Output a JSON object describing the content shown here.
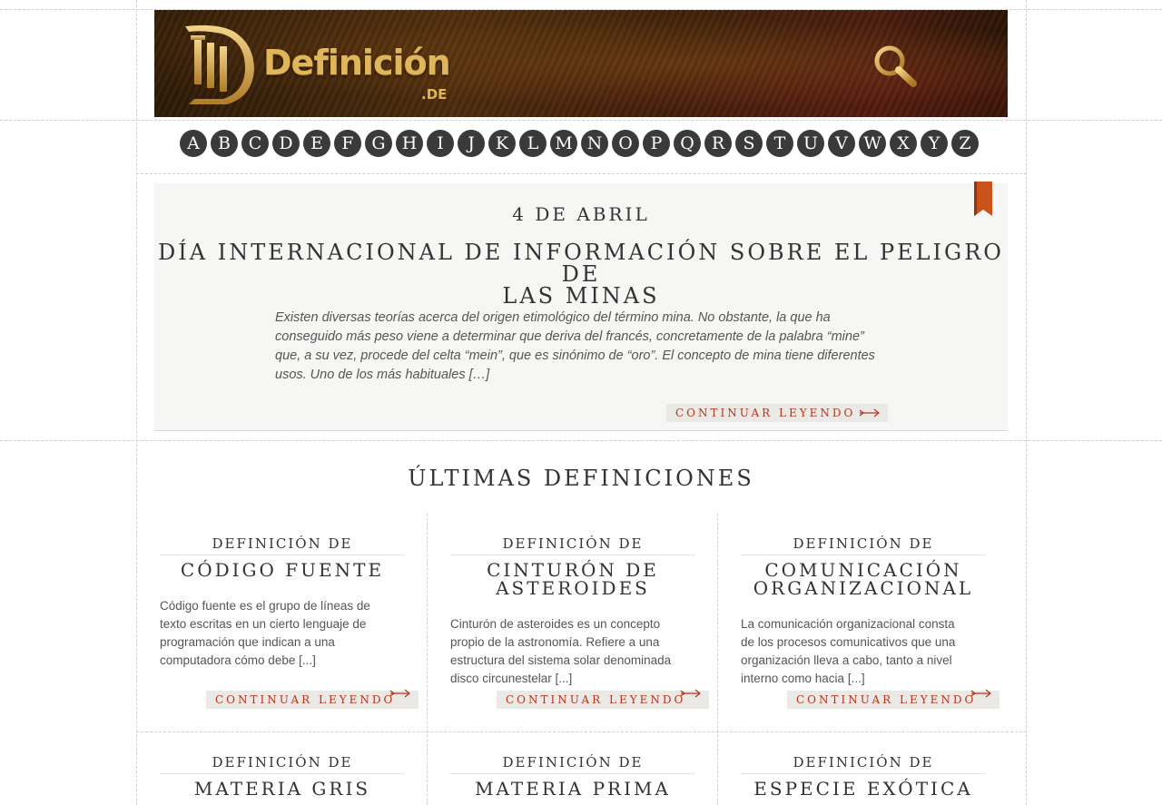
{
  "header": {
    "logo_name": "Definición",
    "logo_tld": ".DE",
    "search_icon": "magnifier-icon"
  },
  "alphabet": [
    "A",
    "B",
    "C",
    "D",
    "E",
    "F",
    "G",
    "H",
    "I",
    "J",
    "K",
    "L",
    "M",
    "N",
    "O",
    "P",
    "Q",
    "R",
    "S",
    "T",
    "U",
    "V",
    "W",
    "X",
    "Y",
    "Z"
  ],
  "featured": {
    "date": "4 DE ABRIL",
    "title_line1": "DÍA INTERNACIONAL DE INFORMACIÓN SOBRE EL PELIGRO DE",
    "title_line2": "LAS MINAS",
    "excerpt": "Existen diversas teorías acerca del origen etimológico del término mina. No obstante, la que ha conseguido más peso viene a determinar que deriva del francés, concretamente de la palabra “mine” que, a su vez, procede del celta “mein”, que es sinónimo de “oro”. El concepto de mina tiene diferentes usos. Uno de los más habituales […]",
    "continue_label": "CONTINUAR LEYENDO",
    "bookmark_color": "#c8541c"
  },
  "latest": {
    "title": "ÚLTIMAS DEFINICIONES",
    "cards": [
      {
        "kicker": "DEFINICIÓN DE",
        "title": "CÓDIGO FUENTE",
        "text": "Código fuente es el grupo de líneas de texto escritas en un cierto lenguaje de programación que indican a una computadora cómo debe [...]",
        "continue_label": "CONTINUAR LEYENDO"
      },
      {
        "kicker": "DEFINICIÓN DE",
        "title_line1": "CINTURÓN DE",
        "title_line2": "ASTEROIDES",
        "text": "Cinturón de asteroides es un concepto propio de la astronomía. Refiere a una estructura del sistema solar denominada disco circunestelar [...]",
        "continue_label": "CONTINUAR LEYENDO"
      },
      {
        "kicker": "DEFINICIÓN DE",
        "title_line1": "COMUNICACIÓN",
        "title_line2": "ORGANIZACIONAL",
        "text": "La comunicación organizacional consta de los procesos comunicativos que una organización lleva a cabo, tanto a nivel interno como hacia [...]",
        "continue_label": "CONTINUAR LEYENDO"
      },
      {
        "kicker": "DEFINICIÓN DE",
        "title": "MATERIA GRIS"
      },
      {
        "kicker": "DEFINICIÓN DE",
        "title": "MATERIA PRIMA"
      },
      {
        "kicker": "DEFINICIÓN DE",
        "title": "ESPECIE EXÓTICA"
      }
    ]
  },
  "colors": {
    "accent": "#b2361c",
    "letter_bg": "#3a3a3a",
    "logo_gold": "#e0b65a"
  }
}
